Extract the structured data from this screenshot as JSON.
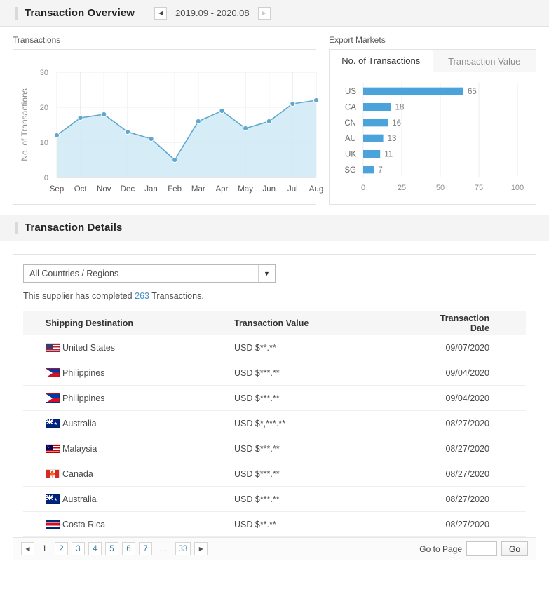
{
  "overview": {
    "title": "Transaction Overview",
    "prev_icon": "triangle-left-icon",
    "next_icon": "triangle-right-icon",
    "date_range": "2019.09 - 2020.08"
  },
  "transactions_caption": "Transactions",
  "export_markets_caption": "Export Markets",
  "tabs": [
    {
      "label": "No. of Transactions",
      "active": true
    },
    {
      "label": "Transaction Value",
      "active": false
    }
  ],
  "details": {
    "title": "Transaction Details",
    "filter_value": "All Countries / Regions",
    "dropdown_icon": "chevron-down-icon",
    "supplier_prefix": "This supplier has completed",
    "supplier_count": "263",
    "supplier_suffix": "Transactions.",
    "columns": [
      "Shipping Destination",
      "Transaction Value",
      "Transaction Date"
    ],
    "rows": [
      {
        "flag": "us",
        "destination": "United States",
        "value": "USD $**.**",
        "date": "09/07/2020"
      },
      {
        "flag": "ph",
        "destination": "Philippines",
        "value": "USD $***.**",
        "date": "09/04/2020"
      },
      {
        "flag": "ph",
        "destination": "Philippines",
        "value": "USD $***.**",
        "date": "09/04/2020"
      },
      {
        "flag": "au",
        "destination": "Australia",
        "value": "USD $*,***.**",
        "date": "08/27/2020"
      },
      {
        "flag": "my",
        "destination": "Malaysia",
        "value": "USD $***.**",
        "date": "08/27/2020"
      },
      {
        "flag": "ca",
        "destination": "Canada",
        "value": "USD $***.**",
        "date": "08/27/2020"
      },
      {
        "flag": "au",
        "destination": "Australia",
        "value": "USD $***.**",
        "date": "08/27/2020"
      },
      {
        "flag": "cr",
        "destination": "Costa Rica",
        "value": "USD $**.**",
        "date": "08/27/2020"
      }
    ]
  },
  "pagination": {
    "prev_icon": "triangle-left-icon",
    "next_icon": "triangle-right-icon",
    "pages": [
      "1",
      "2",
      "3",
      "4",
      "5",
      "6",
      "7",
      "...",
      "33"
    ],
    "current_page": "1",
    "goto_label": "Go to Page",
    "goto_value": "",
    "go_label": "Go"
  },
  "colors": {
    "line_stroke": "#5fa8cd",
    "line_fill": "#cfe9f5",
    "bar": "#4ba3dc",
    "link": "#3d7ea8"
  },
  "chart_data": [
    {
      "type": "area",
      "title": "Transactions",
      "xlabel": "",
      "ylabel": "No. of Transactions",
      "categories": [
        "Sep",
        "Oct",
        "Nov",
        "Dec",
        "Jan",
        "Feb",
        "Mar",
        "Apr",
        "May",
        "Jun",
        "Jul",
        "Aug"
      ],
      "values": [
        12,
        17,
        18,
        13,
        11,
        5,
        16,
        19,
        14,
        16,
        21,
        22
      ],
      "ylim": [
        0,
        30
      ],
      "yticks": [
        0,
        10,
        20,
        30
      ],
      "grid": true,
      "legend": "none"
    },
    {
      "type": "bar",
      "title": "Export Markets",
      "orientation": "horizontal",
      "xlabel": "",
      "ylabel": "",
      "categories": [
        "US",
        "CA",
        "CN",
        "AU",
        "UK",
        "SG"
      ],
      "values": [
        65,
        18,
        16,
        13,
        11,
        7
      ],
      "xlim": [
        0,
        100
      ],
      "xticks": [
        0,
        25,
        50,
        75,
        100
      ],
      "grid": true,
      "legend": "none"
    }
  ]
}
